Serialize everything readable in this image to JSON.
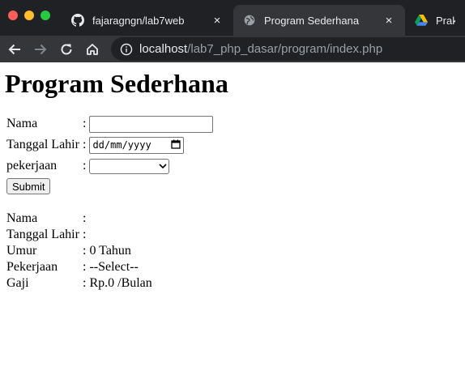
{
  "browser": {
    "tabs": [
      {
        "title": "fajaragngn/lab7web",
        "icon": "github-icon"
      },
      {
        "title": "Program Sederhana",
        "icon": "globe-icon"
      },
      {
        "title": "Praktik",
        "icon": "google-drive-icon"
      }
    ],
    "close_glyph": "×",
    "url_host": "localhost",
    "url_path": "/lab7_php_dasar/program/index.php"
  },
  "page": {
    "heading": "Program Sederhana",
    "form": {
      "nama_label": "Nama",
      "tanggal_label": "Tanggal Lahir",
      "pekerjaan_label": "pekerjaan",
      "colon": ":",
      "nama_value": "",
      "date_placeholder": "dd/mm/yyyy",
      "pekerjaan_value": "",
      "submit_label": "Submit"
    },
    "result": {
      "rows": [
        {
          "label": "Nama",
          "value": ": "
        },
        {
          "label": "Tanggal Lahir",
          "value": ": "
        },
        {
          "label": "Umur",
          "value": ": 0 Tahun"
        },
        {
          "label": "Pekerjaan",
          "value": ": --Select--"
        },
        {
          "label": "Gaji",
          "value": ": Rp.0 /Bulan"
        }
      ]
    }
  },
  "colors": {
    "chrome_bg": "#202124",
    "tab_active_bg": "#35363a",
    "traffic_close": "#ff5f57",
    "traffic_min": "#febc2e",
    "traffic_max": "#28c840"
  }
}
